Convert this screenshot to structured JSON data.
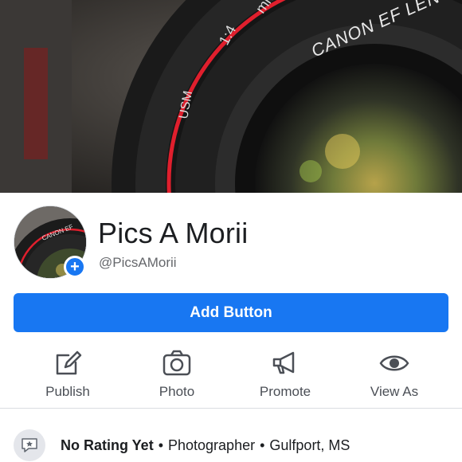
{
  "cover": {
    "lens_text_brand": "CANON EF LENS",
    "lens_text_aperture": "1:4",
    "lens_text_usm": "USM",
    "lens_text_mm": "mm"
  },
  "avatar": {
    "lens_text": "CANON EF"
  },
  "profile": {
    "name": "Pics A Morii",
    "handle": "@PicsAMorii",
    "add_glyph": "+"
  },
  "add_button": {
    "label": "Add Button"
  },
  "actions": [
    {
      "label": "Publish",
      "icon": "edit-icon"
    },
    {
      "label": "Photo",
      "icon": "camera-icon"
    },
    {
      "label": "Promote",
      "icon": "megaphone-icon"
    },
    {
      "label": "View As",
      "icon": "eye-icon"
    }
  ],
  "info": {
    "rating": "No Rating Yet",
    "category": "Photographer",
    "location": "Gulfport, MS",
    "separator": "•"
  },
  "colors": {
    "accent": "#1877f2",
    "muted_text": "#65676b",
    "lens_red": "#e01f2d"
  }
}
